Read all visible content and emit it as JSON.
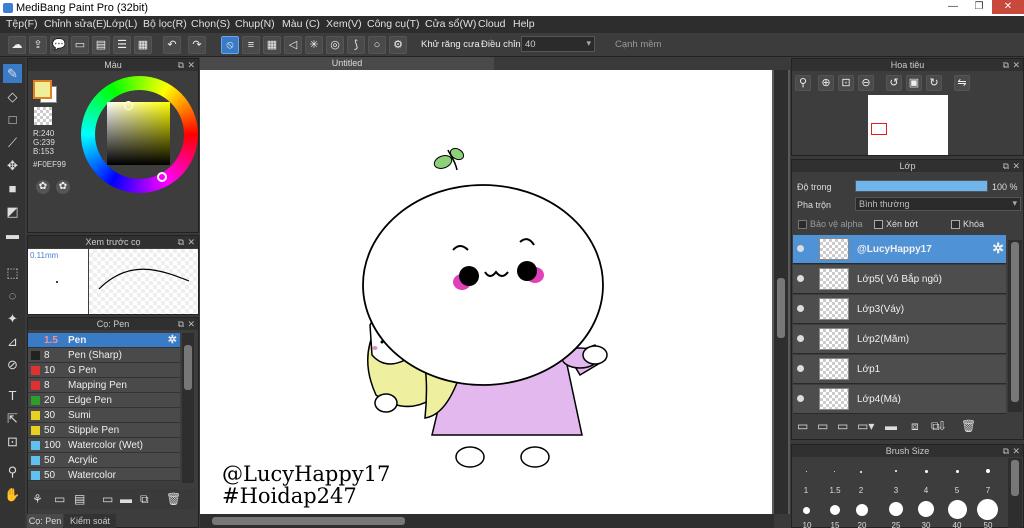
{
  "window": {
    "title": "MediBang Paint Pro (32bit)",
    "min": "—",
    "max": "❐",
    "close": "✕"
  },
  "menu": [
    "Tệp(F)",
    "Chỉnh sửa(E)",
    "Lớp(L)",
    "Bộ lọc(R)",
    "Chọn(S)",
    "Chụp(N)",
    "Màu (C)",
    "Xem(V)",
    "Công cụ(T)",
    "Cửa sổ(W)",
    "Cloud",
    "Help"
  ],
  "toolbar": {
    "antialias_label": "Khử răng cưa",
    "adjust_label": "Điều chỉnh",
    "adjust_value": "40",
    "edge_label": "Cạnh mềm"
  },
  "color_panel": {
    "title": "Màu",
    "r": "R:240",
    "g": "G:239",
    "b": "B:153",
    "hex": "#F0EF99",
    "fg_color": "#F0EF99"
  },
  "preview_panel": {
    "title": "Xem trước cọ",
    "size": "0.11mm"
  },
  "brush_panel": {
    "title": "Cọ: Pen",
    "brushes": [
      {
        "size": "1.5",
        "name": "Pen",
        "color": "#3a7bc8"
      },
      {
        "size": "8",
        "name": "Pen (Sharp)",
        "color": "#222222"
      },
      {
        "size": "10",
        "name": "G Pen",
        "color": "#e03030"
      },
      {
        "size": "8",
        "name": "Mapping Pen",
        "color": "#e03030"
      },
      {
        "size": "20",
        "name": "Edge Pen",
        "color": "#2aa02a"
      },
      {
        "size": "30",
        "name": "Sumi",
        "color": "#e8d020"
      },
      {
        "size": "50",
        "name": "Stipple Pen",
        "color": "#e8d020"
      },
      {
        "size": "100",
        "name": "Watercolor (Wet)",
        "color": "#60c0f0"
      },
      {
        "size": "50",
        "name": "Acrylic",
        "color": "#60c0f0"
      },
      {
        "size": "50",
        "name": "Watercolor",
        "color": "#60c0f0"
      }
    ],
    "tab_pen": "Cọ: Pen",
    "tab_control": "Kiểm soát cọ"
  },
  "canvas": {
    "tab_title": "Untitled",
    "text_line1": "@LucyHappy17",
    "text_line2": "#Hoidap247"
  },
  "navigator": {
    "title": "Hoa tiêu"
  },
  "layer_panel": {
    "title": "Lớp",
    "opacity_label": "Độ trong",
    "opacity_value": "100 %",
    "opacity": 1.0,
    "blend_label": "Pha trộn",
    "blend_value": "Bình thường",
    "protect_alpha": "Bảo vệ alpha",
    "clipping": "Xén bớt",
    "lock": "Khóa",
    "layers": [
      "@LucyHappy17",
      "Lớp5( Vỏ Bắp ngô)",
      "Lớp3(Váy)",
      "Lớp2(Măm)",
      "Lớp1",
      "Lớp4(Má)"
    ]
  },
  "brush_size_panel": {
    "title": "Brush Size",
    "sizes": [
      "1",
      "1.5",
      "2",
      "3",
      "4",
      "5",
      "7"
    ],
    "sizes_row2": [
      "10",
      "15",
      "20",
      "25",
      "30",
      "40",
      "50"
    ]
  }
}
